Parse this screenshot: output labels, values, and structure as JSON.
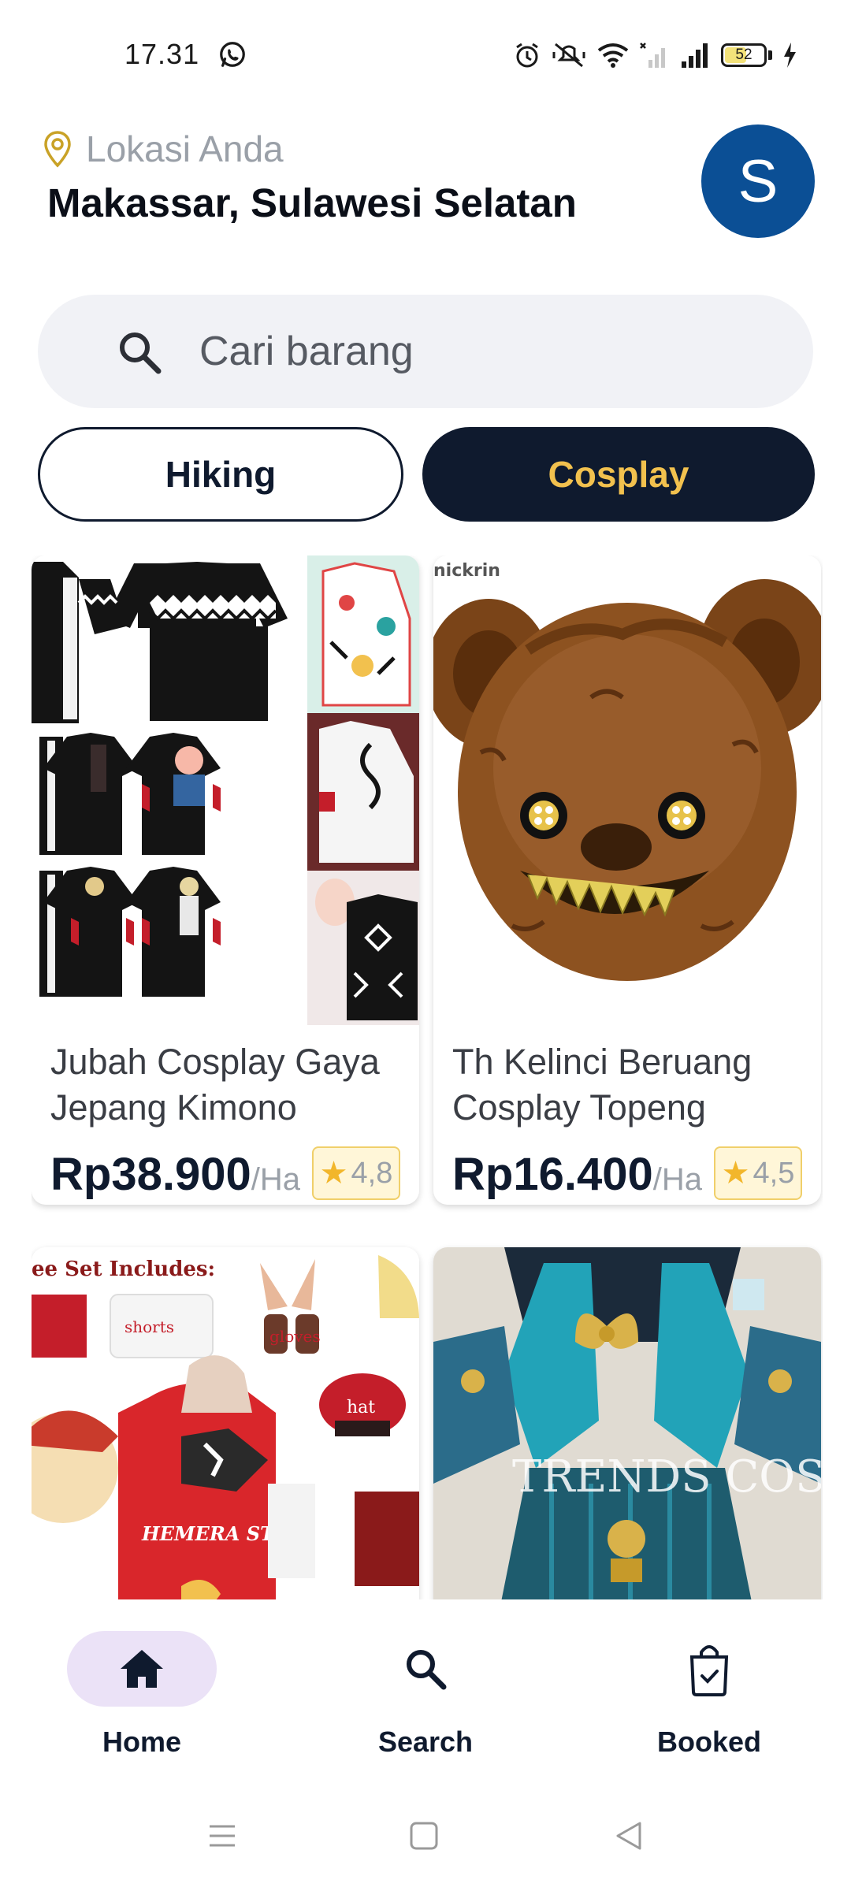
{
  "status_bar": {
    "time": "17.31",
    "battery": "52",
    "battery_level": 0.52
  },
  "header": {
    "location_label": "Lokasi Anda",
    "location_value": "Makassar, Sulawesi Selatan",
    "avatar_initial": "S",
    "avatar_color": "#0b4f95"
  },
  "search": {
    "placeholder": "Cari barang"
  },
  "categories": [
    {
      "label": "Hiking",
      "selected": false
    },
    {
      "label": "Cosplay",
      "selected": true
    }
  ],
  "products": [
    {
      "title": "Jubah Cosplay Gaya Jepang Kimono",
      "price": "Rp38.900",
      "unit": "/Ha",
      "rating": "4,8",
      "image_label": ""
    },
    {
      "title": "Th Kelinci Beruang Cosplay Topeng",
      "price": "Rp16.400",
      "unit": "/Ha",
      "rating": "4,5",
      "image_label": "nickrin"
    },
    {
      "title": "",
      "price": "",
      "unit": "",
      "rating": "",
      "image_label": "ee Set Includes:",
      "image_tags": [
        "shorts",
        "gloves",
        "hat",
        "HEMERA STORE"
      ]
    },
    {
      "title": "",
      "price": "",
      "unit": "",
      "rating": "",
      "image_label": "TRENDS COS"
    }
  ],
  "bottom_nav": [
    {
      "label": "Home",
      "icon": "home-icon",
      "active": true
    },
    {
      "label": "Search",
      "icon": "search-icon",
      "active": false
    },
    {
      "label": "Booked",
      "icon": "shopping-bag-icon",
      "active": false
    }
  ],
  "colors": {
    "primary": "#0f1a2e",
    "accent": "#f2c14e",
    "nav_active_bg": "#ebe2f7"
  }
}
